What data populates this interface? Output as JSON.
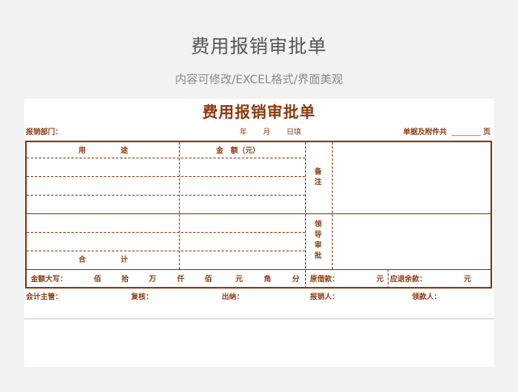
{
  "banner": {
    "title": "费用报销审批单",
    "subtitle": "内容可修改/EXCEL格式/界面美观"
  },
  "form": {
    "title": "费用报销审批单",
    "header": {
      "dept_label": "报销部门：",
      "date_year": "年",
      "date_month": "月",
      "date_day": "日填",
      "attach_label": "单据及附件共",
      "attach_blank": "________",
      "attach_unit": "页"
    },
    "table": {
      "col_usage_1": "用",
      "col_usage_2": "途",
      "col_amount": "金　额（元）",
      "remarks_1": "备",
      "remarks_2": "注",
      "leader_1": "领",
      "leader_2": "导",
      "leader_3": "审",
      "leader_4": "批",
      "total_1": "合",
      "total_2": "计"
    },
    "amount_row": {
      "label": "金额大写：",
      "units": [
        "佰",
        "拾",
        "万",
        "仟",
        "佰",
        "元",
        "角",
        "分"
      ],
      "borrowed_label": "原借款：",
      "borrowed_unit": "元",
      "refund_label": "应退余款：",
      "refund_unit": "元"
    },
    "signatures": {
      "accountant": "会计主管：",
      "reviewer": "复核：",
      "cashier": "出纳：",
      "claimant": "报销人：",
      "receiver": "领款人："
    }
  }
}
